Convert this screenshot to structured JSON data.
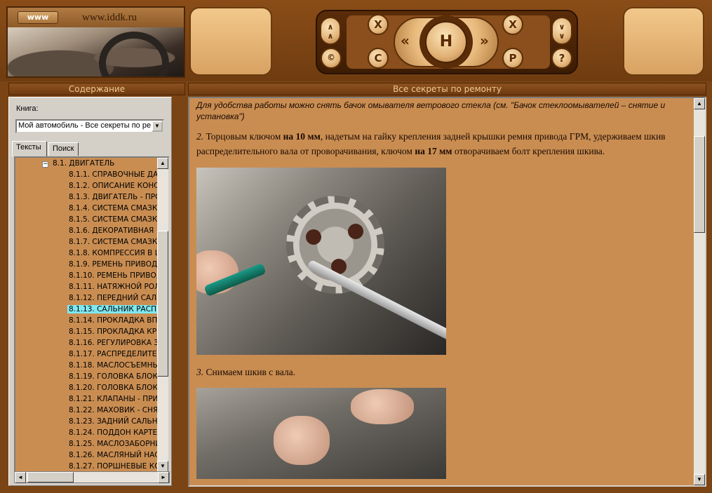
{
  "header": {
    "www_label": "www",
    "site_url": "www.iddk.ru",
    "nav": {
      "up": "∧\n∧",
      "copyright": "©",
      "close_left": "X",
      "c_button": "C",
      "prev": "«",
      "home": "H",
      "next": "»",
      "close_right": "X",
      "p_button": "P",
      "down": "∨\n∨",
      "help": "?"
    }
  },
  "left_title": "Содержание",
  "right_title": "Все секреты по ремонту",
  "sidebar": {
    "book_label": "Книга:",
    "book_value": "Мой автомобиль - Все секреты по ре",
    "tabs": [
      "Тексты",
      "Поиск"
    ],
    "tree_root": {
      "toggle": "−",
      "label": "8.1. ДВИГАТЕЛЬ"
    },
    "tree_items": [
      "8.1.1. СПРАВОЧНЫЕ ДА",
      "8.1.2. ОПИСАНИЕ КОНС",
      "8.1.3. ДВИГАТЕЛЬ - ПРО",
      "8.1.4. СИСТЕМА СМАЗК",
      "8.1.5. СИСТЕМА СМАЗК",
      "8.1.6. ДЕКОРАТИВНАЯ",
      "8.1.7. СИСТЕМА СМАЗК",
      "8.1.8. КОМПРЕССИЯ В Ц",
      "8.1.9. РЕМЕНЬ ПРИВОД",
      "8.1.10. РЕМЕНЬ ПРИВО,",
      "8.1.11. НАТЯЖНОЙ РОЛ",
      "8.1.12. ПЕРЕДНИЙ САЛ",
      "8.1.13. САЛЬНИК РАСПР",
      "8.1.14. ПРОКЛАДКА ВП",
      "8.1.15. ПРОКЛАДКА КР",
      "8.1.16. РЕГУЛИРОВКА З",
      "8.1.17. РАСПРЕДЕЛИТЕ",
      "8.1.18. МАСЛОСЪЕМНЫ",
      "8.1.19. ГОЛОВКА БЛОКА",
      "8.1.20. ГОЛОВКА БЛОКА",
      "8.1.21. КЛАПАНЫ - ПРИ",
      "8.1.22. МАХОВИК - СНЯТ",
      "8.1.23. ЗАДНИЙ САЛЬНИ",
      "8.1.24. ПОДДОН КАРТЕ",
      "8.1.25. МАСЛОЗАБОРНИ",
      "8.1.26. МАСЛЯНЫЙ НАС",
      "8.1.27. ПОРШНЕВЫЕ КО"
    ],
    "selected_item": "8.1.13. САЛЬНИК РАСПР",
    "scroll": {
      "up": "▲",
      "down": "▼",
      "left": "◄",
      "right": "►"
    }
  },
  "content": {
    "note": "Для удобства работы можно снять бачок омывателя ветрового стекла (см. \"Бачок стеклоомывателей – снятие и установка\")",
    "step2": {
      "num": "2.",
      "t1": " Торцовым ключом ",
      "b1": "на 10 мм",
      "t2": ", надетым на гайку крепления задней крышки ремня привода ГРМ, удерживаем шкив распределительного вала от проворачивания, ключом ",
      "b2": "на 17 мм",
      "t3": " отворачиваем болт крепления шкива."
    },
    "step3": {
      "num": "3.",
      "text": " Снимаем шкив с вала."
    }
  }
}
